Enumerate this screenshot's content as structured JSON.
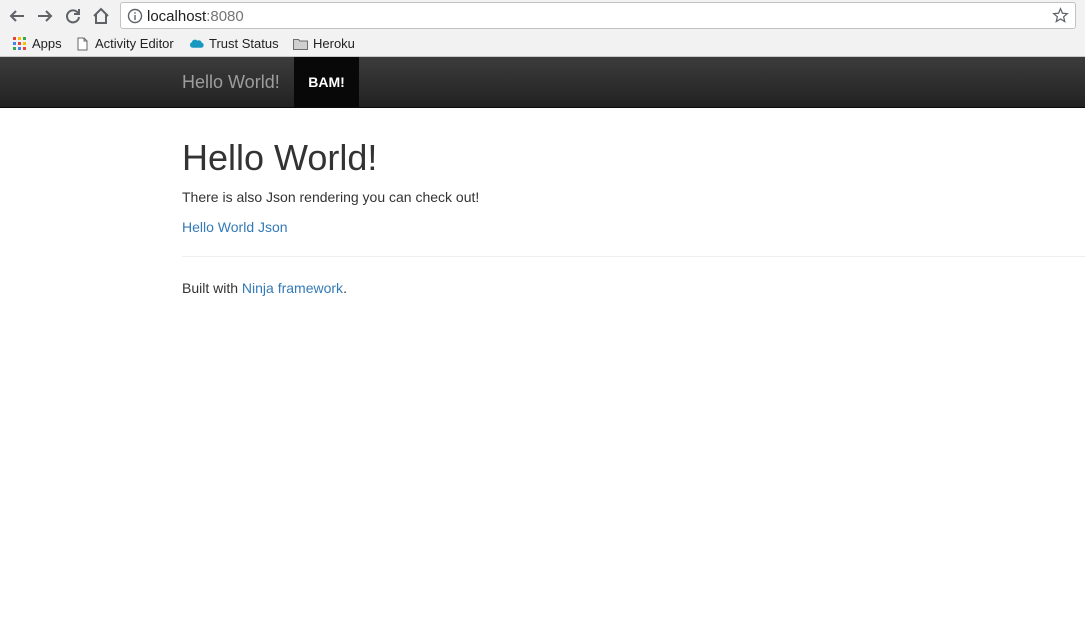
{
  "browser": {
    "url_host": "localhost",
    "url_port": ":8080",
    "bookmarks": [
      {
        "label": "Apps",
        "icon": "apps-grid-icon"
      },
      {
        "label": "Activity Editor",
        "icon": "page-icon"
      },
      {
        "label": "Trust Status",
        "icon": "salesforce-cloud-icon"
      },
      {
        "label": "Heroku",
        "icon": "folder-icon"
      }
    ]
  },
  "navbar": {
    "brand": "Hello World!",
    "active_item": "BAM!"
  },
  "main": {
    "title": "Hello World!",
    "lead": "There is also Json rendering you can check out!",
    "json_link": "Hello World Json"
  },
  "footer": {
    "prefix": "Built with ",
    "link": "Ninja framework",
    "suffix": "."
  },
  "colors": {
    "link": "#337ab7",
    "navbar_dark": "#222222",
    "navbar_active": "#080808",
    "brand_text": "#9d9d9d"
  }
}
